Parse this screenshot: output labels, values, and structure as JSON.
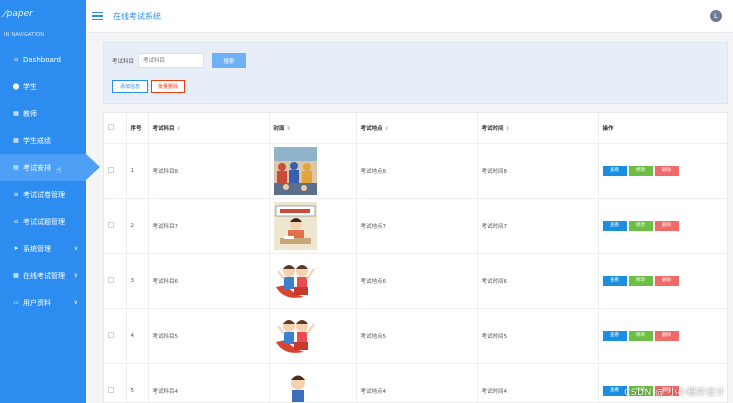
{
  "sidebar": {
    "logo": "paper",
    "nav_title": "IN NAVIGATION",
    "items": [
      {
        "icon": "home-icon",
        "glyph": "⌂",
        "label": "Dashboard"
      },
      {
        "icon": "location-icon",
        "glyph": "⬤",
        "label": "学生"
      },
      {
        "icon": "grid-icon",
        "glyph": "▦",
        "label": "教师"
      },
      {
        "icon": "grid-icon",
        "glyph": "▦",
        "label": "学生成绩"
      },
      {
        "icon": "document-icon",
        "glyph": "▤",
        "label": "考试安排"
      },
      {
        "icon": "list-icon",
        "glyph": "≡",
        "label": "考试试卷管理"
      },
      {
        "icon": "home-icon",
        "glyph": "⌂",
        "label": "考试试题管理"
      },
      {
        "icon": "send-icon",
        "glyph": "➤",
        "label": "系统管理"
      },
      {
        "icon": "grid-icon",
        "glyph": "▦",
        "label": "在线考试管理"
      },
      {
        "icon": "card-icon",
        "glyph": "▭",
        "label": "用户资料"
      }
    ],
    "active_index": 4
  },
  "header": {
    "title": "在线考试系统",
    "avatar": "L"
  },
  "search": {
    "label": "考试科目",
    "placeholder": "考试科目",
    "button": "搜索",
    "add_button": "添加信息",
    "delete_button": "批量删除"
  },
  "table": {
    "headers": {
      "index": "序号",
      "subject": "考试科目",
      "cover": "封面",
      "location": "考试地点",
      "time": "考试时间",
      "actions": "操作"
    },
    "actions": {
      "view": "查看",
      "edit": "修改",
      "delete": "删除"
    },
    "rows": [
      {
        "index": "1",
        "subject": "考试科目8",
        "location": "考试地点8",
        "time": "考试时间8",
        "cover": "classroom"
      },
      {
        "index": "2",
        "subject": "考试科目7",
        "location": "考试地点7",
        "time": "考试时间7",
        "cover": "exam-cartoon"
      },
      {
        "index": "3",
        "subject": "考试科目6",
        "location": "考试地点6",
        "time": "考试时间6",
        "cover": "kids-cartoon"
      },
      {
        "index": "4",
        "subject": "考试科目5",
        "location": "考试地点5",
        "time": "考试时间5",
        "cover": "kids-cartoon"
      },
      {
        "index": "5",
        "subject": "考试科目4",
        "location": "考试地点4",
        "time": "考试时间4",
        "cover": "boy-cartoon"
      }
    ]
  },
  "watermark": "CSDN @ 小小程序设计",
  "colors": {
    "sidebar": "#2d8cf0",
    "view": "#1a8fe0",
    "edit": "#6bbf45",
    "delete": "#f06a6a"
  }
}
